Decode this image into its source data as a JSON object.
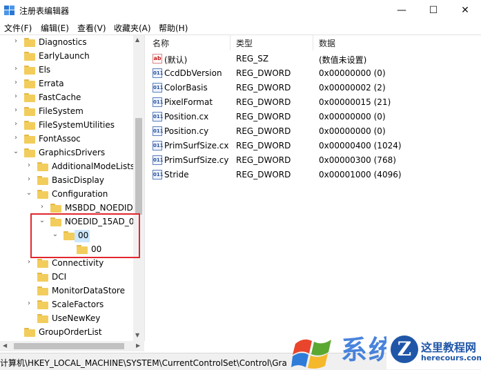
{
  "window": {
    "title": "注册表编辑器",
    "minimize": "—",
    "maximize": "☐",
    "close": "✕"
  },
  "menu": [
    "文件(F)",
    "编辑(E)",
    "查看(V)",
    "收藏夹(A)",
    "帮助(H)"
  ],
  "tree": [
    {
      "label": "Diagnostics",
      "expander": "›"
    },
    {
      "label": "EarlyLaunch",
      "expander": ""
    },
    {
      "label": "Els",
      "expander": "›"
    },
    {
      "label": "Errata",
      "expander": "›"
    },
    {
      "label": "FastCache",
      "expander": "›"
    },
    {
      "label": "FileSystem",
      "expander": "›"
    },
    {
      "label": "FileSystemUtilities",
      "expander": "›"
    },
    {
      "label": "FontAssoc",
      "expander": "›"
    },
    {
      "label": "GraphicsDrivers",
      "expander": "⌄"
    },
    {
      "label": "AdditionalModeLists",
      "expander": "›"
    },
    {
      "label": "BasicDisplay",
      "expander": "›"
    },
    {
      "label": "Configuration",
      "expander": "⌄"
    },
    {
      "label": "MSBDD_NOEDID",
      "expander": "›"
    },
    {
      "label": "NOEDID_15AD_0",
      "expander": "⌄"
    },
    {
      "label": "00",
      "expander": "⌄"
    },
    {
      "label": "00",
      "expander": ""
    },
    {
      "label": "Connectivity",
      "expander": "›"
    },
    {
      "label": "DCI",
      "expander": ""
    },
    {
      "label": "MonitorDataStore",
      "expander": ""
    },
    {
      "label": "ScaleFactors",
      "expander": "›"
    },
    {
      "label": "UseNewKey",
      "expander": ""
    },
    {
      "label": "GroupOrderList",
      "expander": ""
    }
  ],
  "list": {
    "headers": [
      "名称",
      "类型",
      "数据"
    ],
    "rows": [
      {
        "icon": "ab",
        "name": "(默认)",
        "type": "REG_SZ",
        "data": "(数值未设置)"
      },
      {
        "icon": "011",
        "name": "CcdDbVersion",
        "type": "REG_DWORD",
        "data": "0x00000000 (0)"
      },
      {
        "icon": "011",
        "name": "ColorBasis",
        "type": "REG_DWORD",
        "data": "0x00000002 (2)"
      },
      {
        "icon": "011",
        "name": "PixelFormat",
        "type": "REG_DWORD",
        "data": "0x00000015 (21)"
      },
      {
        "icon": "011",
        "name": "Position.cx",
        "type": "REG_DWORD",
        "data": "0x00000000 (0)"
      },
      {
        "icon": "011",
        "name": "Position.cy",
        "type": "REG_DWORD",
        "data": "0x00000000 (0)"
      },
      {
        "icon": "011",
        "name": "PrimSurfSize.cx",
        "type": "REG_DWORD",
        "data": "0x00000400 (1024)"
      },
      {
        "icon": "011",
        "name": "PrimSurfSize.cy",
        "type": "REG_DWORD",
        "data": "0x00000300 (768)"
      },
      {
        "icon": "011",
        "name": "Stride",
        "type": "REG_DWORD",
        "data": "0x00001000 (4096)"
      }
    ]
  },
  "status_path": "计算机\\HKEY_LOCAL_MACHINE\\SYSTEM\\CurrentControlSet\\Control\\Gra",
  "watermark": {
    "chars": "系统之家",
    "circle": "Z",
    "text1": "这里教程网",
    "text2": "herecours.com"
  },
  "colors": {
    "selection": "#cce8ff",
    "highlight_box": "#e0262c",
    "folder": "#f2cd5c"
  }
}
